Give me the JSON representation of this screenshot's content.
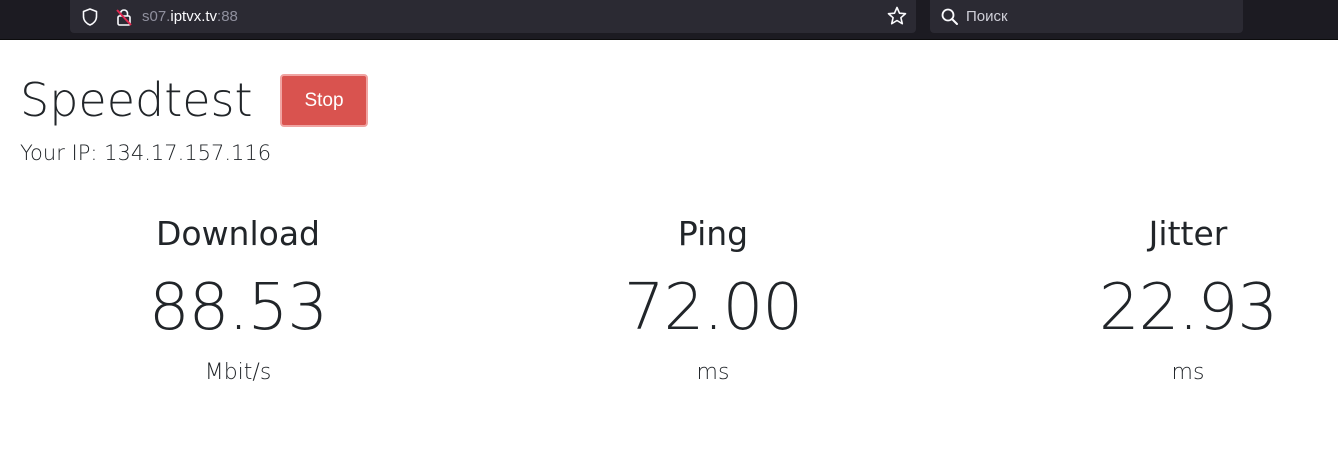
{
  "browser": {
    "url_prefix": "s07.",
    "url_host": "iptvx.tv",
    "url_suffix": ":88",
    "search_placeholder": "Поиск",
    "icons": {
      "shield": "tracking-protection-shield-icon",
      "lock": "insecure-lock-icon",
      "star": "bookmark-star-icon",
      "search": "search-icon"
    }
  },
  "page": {
    "title": "Speedtest",
    "stop_label": "Stop",
    "ip_text": "Your IP: 134.17.157.116"
  },
  "metrics": [
    {
      "label": "Download",
      "value": "88.53",
      "unit": "Mbit/s"
    },
    {
      "label": "Ping",
      "value": "72.00",
      "unit": "ms"
    },
    {
      "label": "Jitter",
      "value": "22.93",
      "unit": "ms"
    }
  ],
  "colors": {
    "stop_button": "#d9534f",
    "text": "#212529",
    "chrome_bg": "#1c1b22",
    "insecure_red": "#e22850"
  }
}
